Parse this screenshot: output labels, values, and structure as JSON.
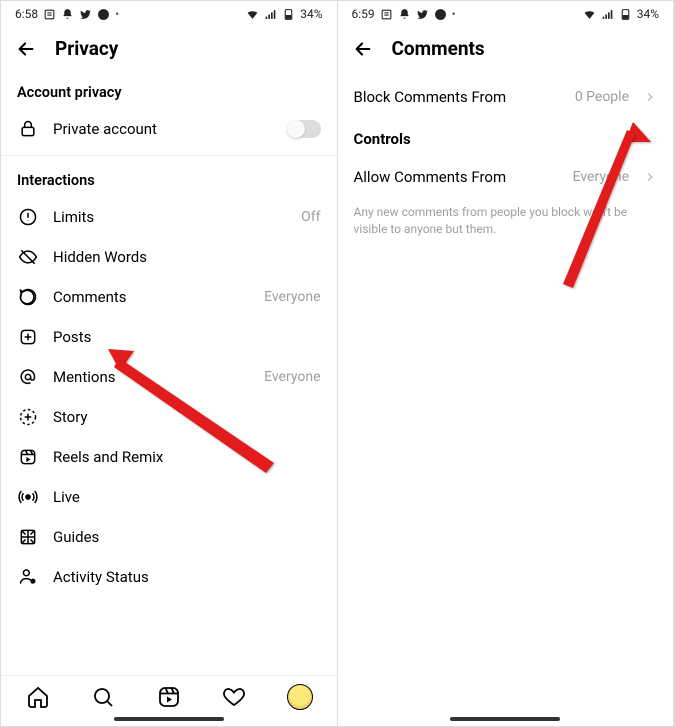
{
  "left": {
    "status": {
      "time": "6:58",
      "battery": "34%"
    },
    "header": {
      "title": "Privacy"
    },
    "account_section": "Account privacy",
    "private_account": "Private account",
    "interactions_section": "Interactions",
    "rows": {
      "limits": {
        "label": "Limits",
        "value": "Off"
      },
      "hidden": {
        "label": "Hidden Words",
        "value": ""
      },
      "comments": {
        "label": "Comments",
        "value": "Everyone"
      },
      "posts": {
        "label": "Posts",
        "value": ""
      },
      "mentions": {
        "label": "Mentions",
        "value": "Everyone"
      },
      "story": {
        "label": "Story",
        "value": ""
      },
      "reels": {
        "label": "Reels and Remix",
        "value": ""
      },
      "live": {
        "label": "Live",
        "value": ""
      },
      "guides": {
        "label": "Guides",
        "value": ""
      },
      "activity": {
        "label": "Activity Status",
        "value": ""
      }
    }
  },
  "right": {
    "status": {
      "time": "6:59",
      "battery": "34%"
    },
    "header": {
      "title": "Comments"
    },
    "block_row": {
      "label": "Block Comments From",
      "value": "0 People"
    },
    "controls_section": "Controls",
    "allow_row": {
      "label": "Allow Comments From",
      "value": "Everyone"
    },
    "helper": "Any new comments from people you block won't be visible to anyone but them."
  }
}
